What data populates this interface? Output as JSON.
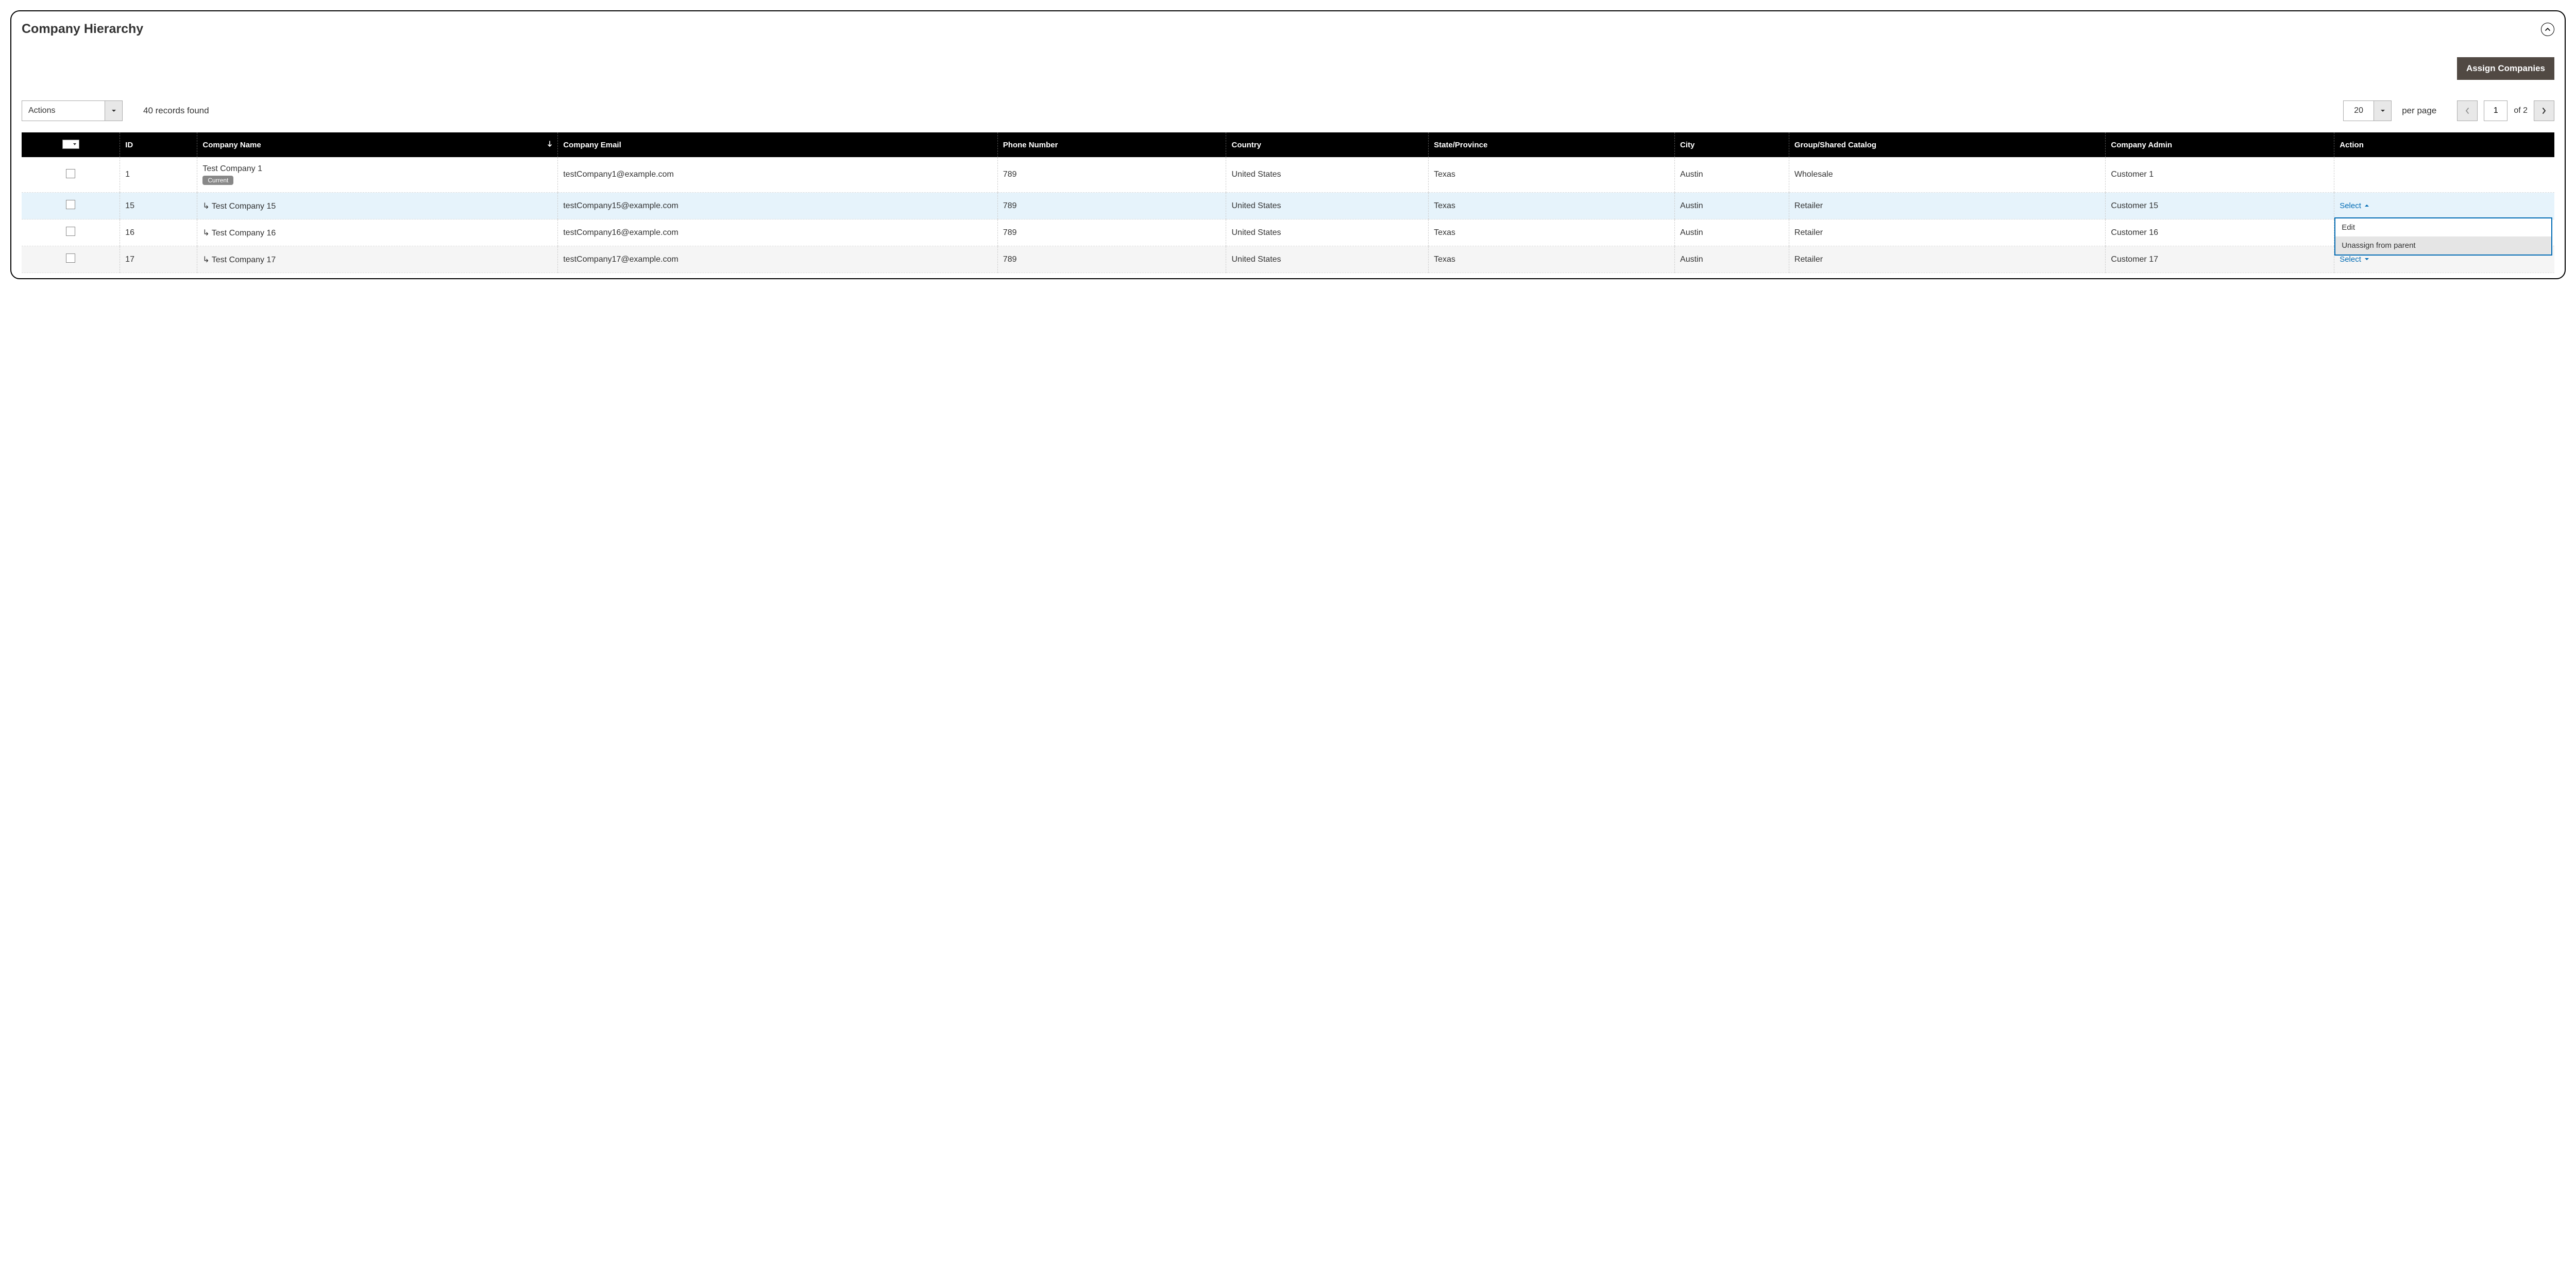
{
  "panel": {
    "title": "Company Hierarchy"
  },
  "buttons": {
    "assign": "Assign Companies"
  },
  "toolbar": {
    "actions_label": "Actions",
    "records_found": "40 records found",
    "page_size": "20",
    "per_page": "per page",
    "current_page": "1",
    "page_total_label": "of 2"
  },
  "columns": {
    "id": "ID",
    "company_name": "Company Name",
    "company_email": "Company Email",
    "phone": "Phone Number",
    "country": "Country",
    "state": "State/Province",
    "city": "City",
    "group": "Group/Shared Catalog",
    "admin": "Company Admin",
    "action": "Action"
  },
  "badge_current": "Current",
  "action_link": "Select",
  "dropdown": {
    "edit": "Edit",
    "unassign": "Unassign from parent"
  },
  "rows": [
    {
      "id": "1",
      "name": "Test Company 1",
      "email": "testCompany1@example.com",
      "phone": "789",
      "country": "United States",
      "state": "Texas",
      "city": "Austin",
      "group": "Wholesale",
      "admin": "Customer 1",
      "is_current": true,
      "is_child": false,
      "has_action": false,
      "highlight": false,
      "alt": false,
      "dropdown_open": false
    },
    {
      "id": "15",
      "name": "Test Company 15",
      "email": "testCompany15@example.com",
      "phone": "789",
      "country": "United States",
      "state": "Texas",
      "city": "Austin",
      "group": "Retailer",
      "admin": "Customer 15",
      "is_current": false,
      "is_child": true,
      "has_action": true,
      "highlight": true,
      "alt": false,
      "dropdown_open": true
    },
    {
      "id": "16",
      "name": "Test Company 16",
      "email": "testCompany16@example.com",
      "phone": "789",
      "country": "United States",
      "state": "Texas",
      "city": "Austin",
      "group": "Retailer",
      "admin": "Customer 16",
      "is_current": false,
      "is_child": true,
      "has_action": false,
      "highlight": false,
      "alt": false,
      "dropdown_open": false
    },
    {
      "id": "17",
      "name": "Test Company 17",
      "email": "testCompany17@example.com",
      "phone": "789",
      "country": "United States",
      "state": "Texas",
      "city": "Austin",
      "group": "Retailer",
      "admin": "Customer 17",
      "is_current": false,
      "is_child": true,
      "has_action": true,
      "highlight": false,
      "alt": true,
      "dropdown_open": false
    }
  ]
}
